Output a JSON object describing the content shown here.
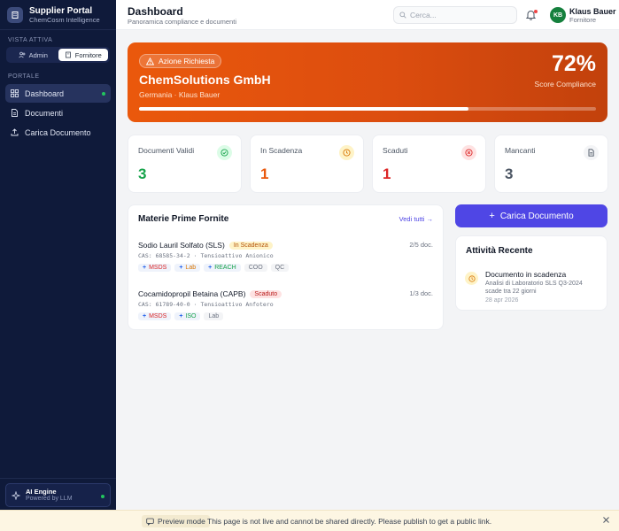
{
  "sidebar": {
    "brand_title": "Supplier Portal",
    "brand_subtitle": "ChemCosm Intelligence",
    "view_label": "VISTA ATTIVA",
    "view_options": [
      "Admin",
      "Fornitore"
    ],
    "view_selected": "Fornitore",
    "portal_label": "PORTALE",
    "nav": [
      {
        "label": "Dashboard",
        "icon": "grid-icon",
        "active": true
      },
      {
        "label": "Documenti",
        "icon": "document-icon",
        "active": false
      },
      {
        "label": "Carica Documento",
        "icon": "upload-icon",
        "active": false
      }
    ],
    "ai": {
      "title": "AI Engine",
      "subtitle": "Powered by LLM",
      "icon": "sparkle-icon"
    }
  },
  "header": {
    "title": "Dashboard",
    "subtitle": "Panoramica compliance e documenti",
    "search_placeholder": "Cerca...",
    "user_initials": "KB",
    "user_name": "Klaus Bauer",
    "user_role": "Fornitore"
  },
  "hero": {
    "badge": "Azione Richiesta",
    "company": "ChemSolutions GmbH",
    "meta": "Germania · Klaus Bauer",
    "score": "72%",
    "score_value": 72,
    "score_label": "Score Compliance",
    "color": "#ea580c"
  },
  "stats": [
    {
      "label": "Documenti Validi",
      "value": "3",
      "color": "#16a34a",
      "icon": "check-circle-icon"
    },
    {
      "label": "In Scadenza",
      "value": "1",
      "color": "#ea580c",
      "icon": "clock-icon"
    },
    {
      "label": "Scaduti",
      "value": "1",
      "color": "#dc2626",
      "icon": "x-circle-icon"
    },
    {
      "label": "Mancanti",
      "value": "3",
      "color": "#4b5563",
      "icon": "file-icon"
    }
  ],
  "materials": {
    "title": "Materie Prime Fornite",
    "see_all": "Vedi tutti →",
    "items": [
      {
        "name": "Sodio Lauril Solfato (SLS)",
        "status": "In Scadenza",
        "cas": "CAS: 68585-34-2 · Tensioattivo Anionico",
        "docs": "2/5 doc.",
        "tags": [
          {
            "label": "MSDS",
            "color": "#dc2626",
            "bg": "#fee2e2",
            "plus": "#2563eb"
          },
          {
            "label": "Lab",
            "color": "#d97706",
            "bg": "#fef3c7",
            "plus": "#2563eb"
          },
          {
            "label": "REACH",
            "color": "#16a34a",
            "bg": "#dcfce7",
            "plus": "#2563eb"
          },
          {
            "label": "COO",
            "color": "#6b7280",
            "bg": "#f3f4f6",
            "plus": ""
          },
          {
            "label": "QC",
            "color": "#6b7280",
            "bg": "#f3f4f6",
            "plus": ""
          }
        ]
      },
      {
        "name": "Cocamidopropil Betaina (CAPB)",
        "status": "Scaduto",
        "cas": "CAS: 61789-40-0 · Tensioattivo Anfotero",
        "docs": "1/3 doc.",
        "tags": [
          {
            "label": "MSDS",
            "color": "#dc2626",
            "bg": "#fee2e2",
            "plus": "#2563eb"
          },
          {
            "label": "ISO",
            "color": "#16a34a",
            "bg": "#dcfce7",
            "plus": "#2563eb"
          },
          {
            "label": "Lab",
            "color": "#6b7280",
            "bg": "#f3f4f6",
            "plus": ""
          }
        ]
      }
    ]
  },
  "upload_button": "Carica Documento",
  "activity": {
    "title": "Attività Recente",
    "item": {
      "title": "Documento in scadenza",
      "desc": "Analisi di Laboratorio SLS Q3-2024 scade tra 22 giorni",
      "date": "28 apr 2026"
    }
  },
  "preview": {
    "tag": "Preview mode",
    "message": "This page is not live and cannot be shared directly. Please publish to get a public link."
  }
}
